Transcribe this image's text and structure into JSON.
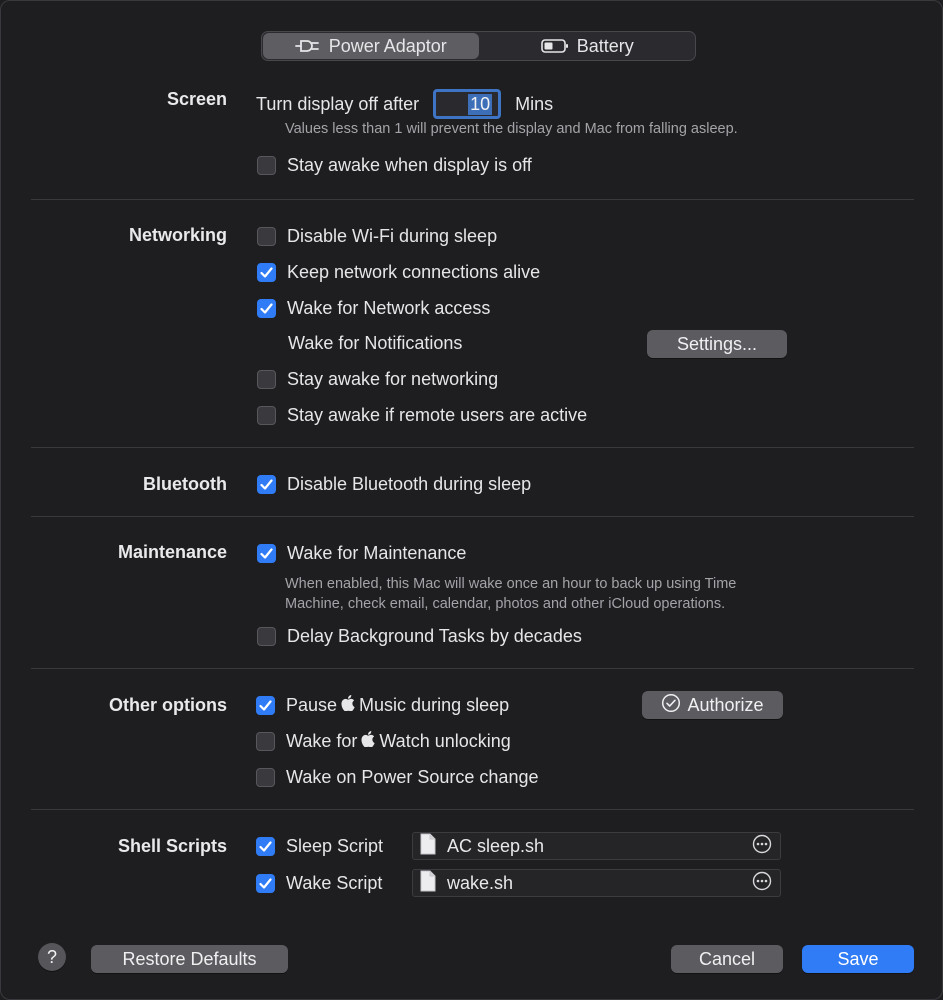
{
  "tabs": [
    {
      "label": "Power Adaptor",
      "icon": "power-plug-icon",
      "active": true
    },
    {
      "label": "Battery",
      "icon": "battery-icon",
      "active": false
    }
  ],
  "screen": {
    "label": "Screen",
    "display_off_prefix": "Turn display off after",
    "display_off_value": "10",
    "display_off_unit": "Mins",
    "help": "Values less than 1 will prevent the display and Mac from falling asleep.",
    "stay_awake": {
      "label": "Stay awake when display is off",
      "checked": false
    }
  },
  "networking": {
    "label": "Networking",
    "disable_wifi": {
      "label": "Disable Wi-Fi during sleep",
      "checked": false
    },
    "keep_alive": {
      "label": "Keep network connections alive",
      "checked": true
    },
    "wake_network": {
      "label": "Wake for Network access",
      "checked": true
    },
    "wake_notifications": {
      "label": "Wake for Notifications"
    },
    "settings_button": "Settings...",
    "stay_awake_networking": {
      "label": "Stay awake for networking",
      "checked": false
    },
    "stay_awake_remote": {
      "label": "Stay awake if remote users are active",
      "checked": false
    }
  },
  "bluetooth": {
    "label": "Bluetooth",
    "disable_bt": {
      "label": "Disable Bluetooth during sleep",
      "checked": true
    }
  },
  "maintenance": {
    "label": "Maintenance",
    "wake_maintenance": {
      "label": "Wake for Maintenance",
      "checked": true
    },
    "help_line1": "When enabled, this Mac will wake once an hour to back up using Time",
    "help_line2": "Machine, check email, calendar, photos and other iCloud operations.",
    "delay_tasks": {
      "label": "Delay Background Tasks by decades",
      "checked": false
    }
  },
  "other": {
    "label": "Other options",
    "pause_music": {
      "prefix": "Pause",
      "suffix": "Music during sleep",
      "checked": true
    },
    "authorize_button": "Authorize",
    "wake_watch": {
      "prefix": "Wake for",
      "suffix": "Watch unlocking",
      "checked": false
    },
    "wake_power": {
      "label": "Wake on Power Source change",
      "checked": false
    }
  },
  "scripts": {
    "label": "Shell Scripts",
    "sleep": {
      "label": "Sleep Script",
      "checked": true,
      "file": "AC sleep.sh"
    },
    "wake": {
      "label": "Wake Script",
      "checked": true,
      "file": "wake.sh"
    }
  },
  "footer": {
    "help": "?",
    "restore": "Restore Defaults",
    "cancel": "Cancel",
    "save": "Save"
  },
  "colors": {
    "accent": "#2f7cf6",
    "background": "#1e1e21"
  }
}
